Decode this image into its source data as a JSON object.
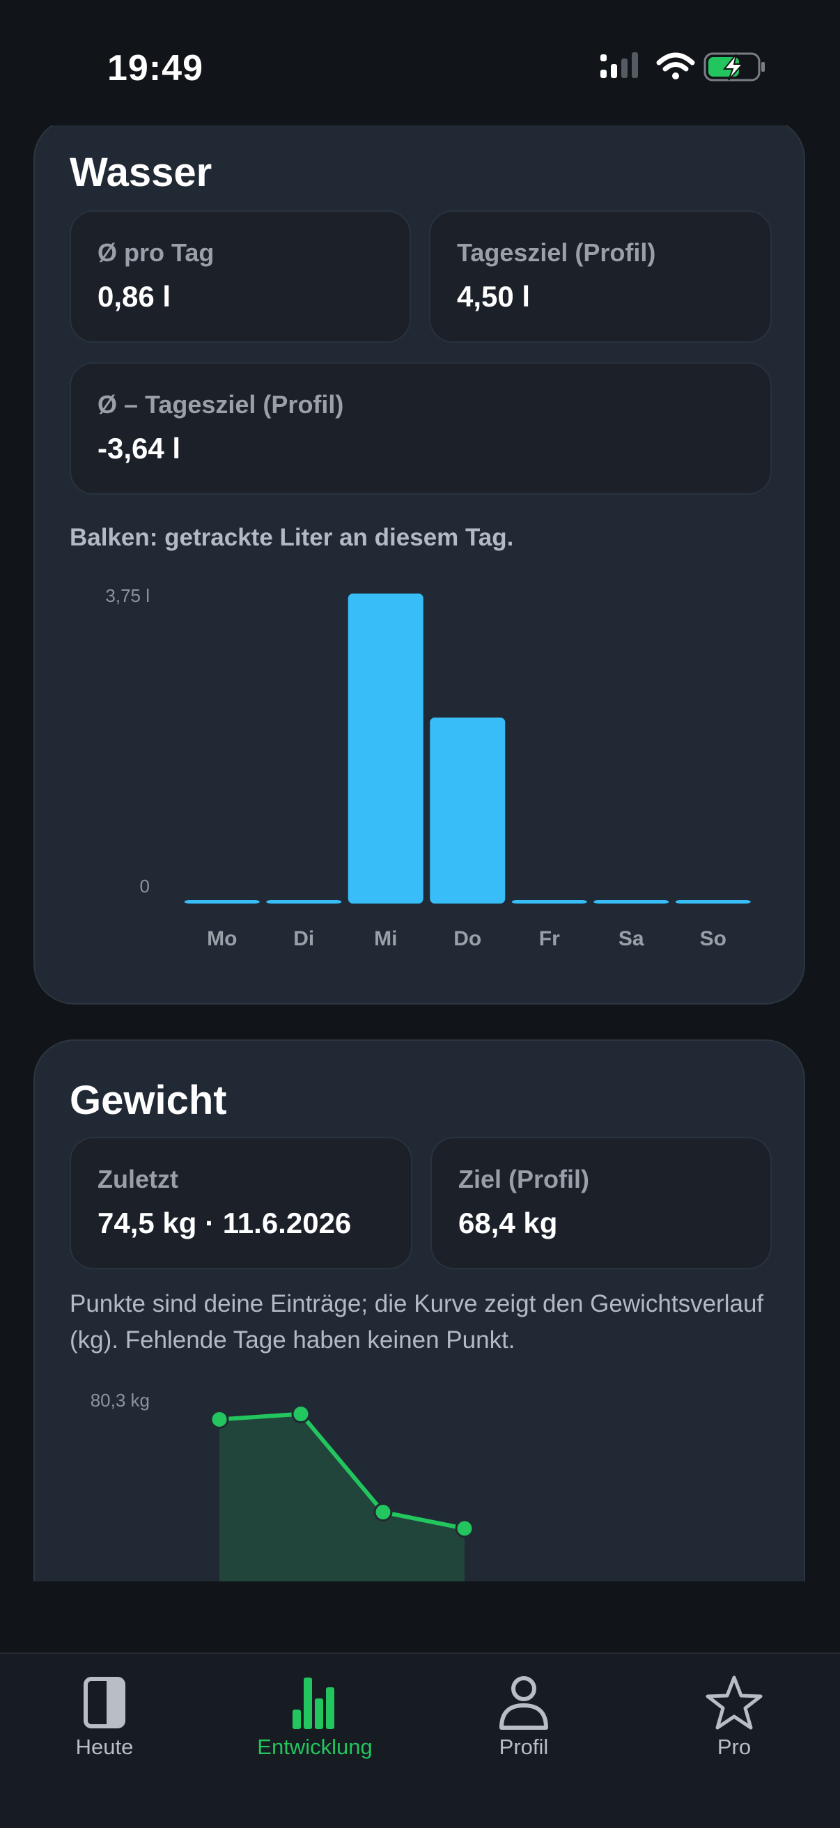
{
  "status": {
    "time": "19:49"
  },
  "water": {
    "title": "Wasser",
    "avg_label": "Ø pro Tag",
    "avg_value": "0,86 l",
    "goal_label": "Tagesziel (Profil)",
    "goal_value": "4,50 l",
    "diff_label": "Ø – Tagesziel (Profil)",
    "diff_value": "-3,64 l",
    "hint": "Balken: getrackte Liter an diesem Tag."
  },
  "weight": {
    "title": "Gewicht",
    "last_label": "Zuletzt",
    "last_value": "74,5 kg · 11.6.2026",
    "goal_label": "Ziel (Profil)",
    "goal_value": "68,4 kg",
    "hint": "Punkte sind deine Einträge; die Kurve zeigt den Gewichtsverlauf (kg). Fehlende Tage haben keinen Punkt."
  },
  "chart_data": [
    {
      "type": "bar",
      "title": "",
      "categories": [
        "Mo",
        "Di",
        "Mi",
        "Do",
        "Fr",
        "Sa",
        "So"
      ],
      "values": [
        0,
        0,
        3.75,
        2.25,
        0,
        0,
        0
      ],
      "y_tick_labels": [
        "3,75 l",
        "0"
      ],
      "ylim": [
        0,
        3.75
      ],
      "color": "#38bdf8",
      "grid": false
    },
    {
      "type": "area",
      "title": "",
      "points": [
        80.0,
        80.1,
        78.3,
        78.0
      ],
      "y_tick_labels": [
        "80,3 kg"
      ],
      "color": "#22c55e",
      "grid": false
    }
  ],
  "tabs": [
    {
      "label": "Heute",
      "icon": "book-icon",
      "active": false
    },
    {
      "label": "Entwicklung",
      "icon": "bar-chart-icon",
      "active": true
    },
    {
      "label": "Profil",
      "icon": "person-icon",
      "active": false
    },
    {
      "label": "Pro",
      "icon": "star-icon",
      "active": false
    }
  ],
  "colors": {
    "accent": "#22c55e",
    "bar": "#38bdf8",
    "background": "#111418",
    "card": "#212934"
  }
}
